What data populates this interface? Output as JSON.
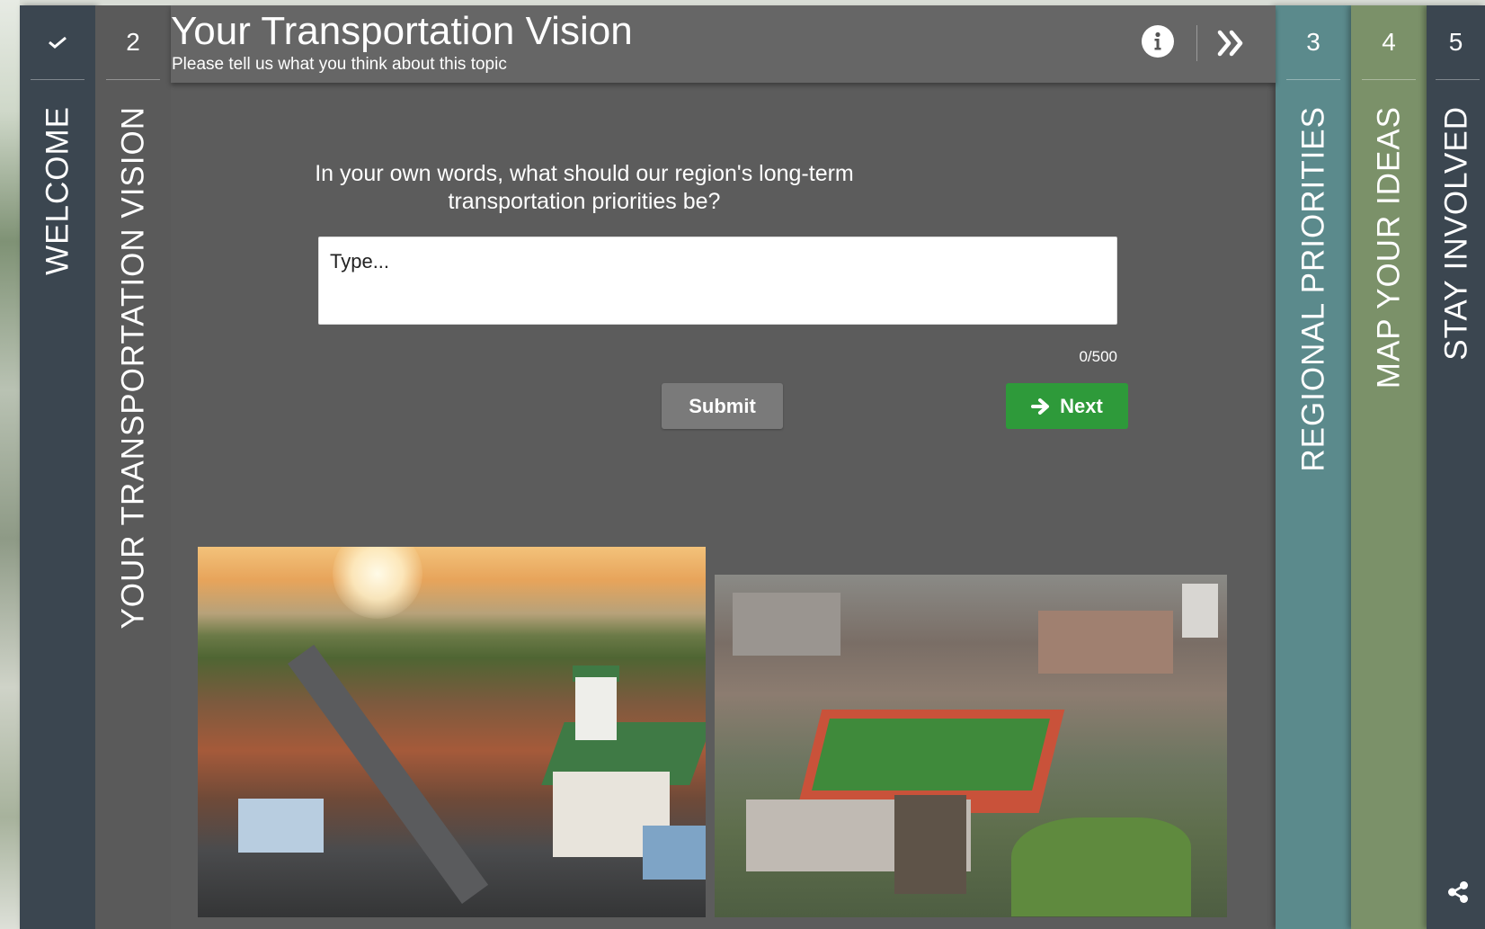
{
  "tabs": [
    {
      "number": "",
      "label": "WELCOME",
      "completed": true,
      "color": "#3b4650"
    },
    {
      "number": "2",
      "label": "YOUR TRANSPORTATION VISION",
      "active": true,
      "color": "#5a5a5a"
    },
    {
      "number": "3",
      "label": "REGIONAL PRIORITIES",
      "color": "#5b8a8c"
    },
    {
      "number": "4",
      "label": "MAP YOUR IDEAS",
      "color": "#7b9169"
    },
    {
      "number": "5",
      "label": "STAY INVOLVED",
      "color": "#3b4650"
    }
  ],
  "header": {
    "title": "Your Transportation Vision",
    "subtitle": "Please tell us what you think about this topic",
    "info_icon": "info-icon",
    "collapse_icon": "double-chevron-right-icon"
  },
  "form": {
    "question": "In your own words, what should our region's long-term transportation priorities be?",
    "placeholder": "Type...",
    "value": "",
    "char_count": "0/500",
    "submit_label": "Submit",
    "next_label": "Next"
  },
  "colors": {
    "accent_green": "#2e9a3a",
    "panel_bg": "#5c5c5c",
    "header_bg": "#666666"
  }
}
